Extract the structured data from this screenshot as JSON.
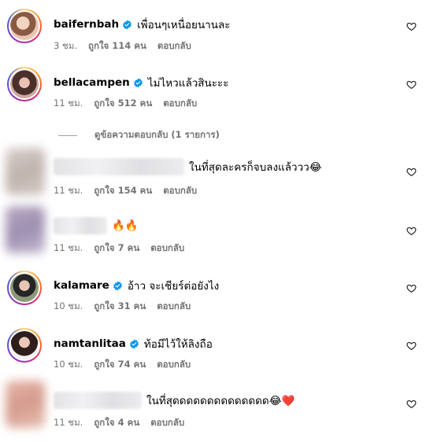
{
  "comments": [
    {
      "username": "baifernbah",
      "verified": true,
      "text": "เพื่อนๆเหนื่อยนานละ",
      "time": "3 ชม.",
      "likes": "ถูกใจ 114 คน",
      "reply": "ตอบกลับ"
    },
    {
      "username": "bellacampen",
      "verified": true,
      "text": "ไม่ไหวแล้วสินะะะ",
      "time": "11 ชม.",
      "likes": "ถูกใจ 512 คน",
      "reply": "ตอบกลับ"
    },
    {
      "username": "",
      "verified": false,
      "text": "ในที่สุดละครก็จบลงแล้ววว😂",
      "time": "11 ชม.",
      "likes": "ถูกใจ 154 คน",
      "reply": "ตอบกลับ"
    },
    {
      "username": "",
      "verified": false,
      "text": "🔥🔥",
      "time": "11 ชม.",
      "likes": "ถูกใจ 7 คน",
      "reply": "ตอบกลับ"
    },
    {
      "username": "kalamare",
      "verified": true,
      "text": "อ้าว จะเชียร์ต่อยังไง",
      "time": "10 ชม.",
      "likes": "ถูกใจ 31 คน",
      "reply": "ตอบกลับ"
    },
    {
      "username": "namtanlitaa",
      "verified": true,
      "text": "ท้อมีไว้ให้ลิงถือ",
      "time": "10 ชม.",
      "likes": "ถูกใจ 74 คน",
      "reply": "ตอบกลับ"
    },
    {
      "username": "",
      "verified": false,
      "text": "ในที่สุดดดดดดดดดดดดดด😂❤️",
      "time": "11 ชม.",
      "likes": "ถูกใจ 4 คน",
      "reply": "ตอบกลับ"
    }
  ],
  "view_replies": "ดูข้อความตอบกลับ (1 รายการ)",
  "icons": {
    "verified": "verified-badge-icon",
    "like": "heart-outline-icon"
  },
  "colors": {
    "verified_blue": "#0095f6",
    "meta_gray": "#737373"
  }
}
